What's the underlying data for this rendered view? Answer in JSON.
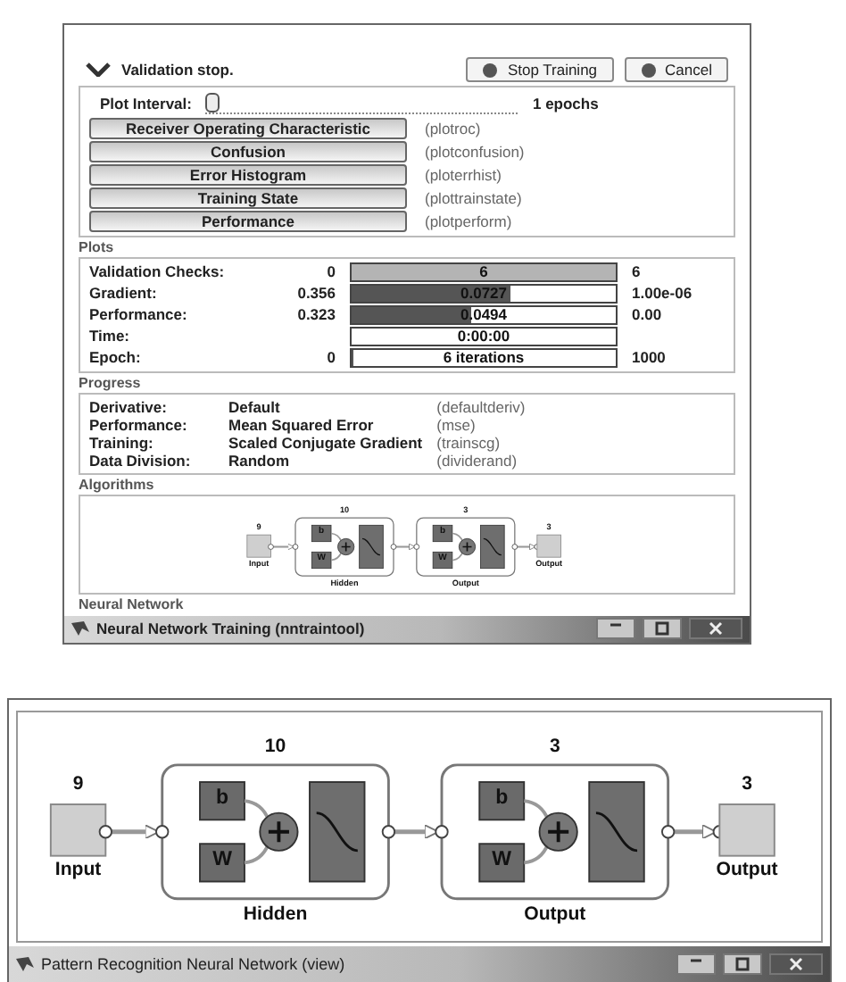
{
  "training_window": {
    "status": "Validation stop.",
    "buttons": [
      "Stop Training",
      "Cancel"
    ],
    "plot_interval": {
      "label": "Plot Interval:",
      "level": 0,
      "reading": "1 epochs"
    },
    "plots": {
      "buttons": [
        {
          "label": "Receiver Operating Characteristic",
          "function": "(plotroc)"
        },
        {
          "label": "Confusion",
          "function": "(plotconfusion)"
        },
        {
          "label": "Error Histogram",
          "function": "(ploterrhist)"
        },
        {
          "label": "Training State",
          "function": "(plottrainstate)"
        },
        {
          "label": "Performance",
          "function": "(plotperform)"
        }
      ],
      "heading": "Plots"
    },
    "progress": {
      "rows": [
        {
          "label": "Validation Checks:",
          "start": "0",
          "reading": "6",
          "end": "6",
          "level": 1,
          "color": "#b4b4b4"
        },
        {
          "label": "Gradient:",
          "start": "0.356",
          "reading": "0.0727",
          "end": "1.00e-06",
          "level": 0.6,
          "color": "#555555"
        },
        {
          "label": "Performance:",
          "start": "0.323",
          "reading": "0.0494",
          "end": "0.00",
          "level": 0.45,
          "color": "#555555"
        },
        {
          "label": "Time:",
          "reading": "0:00:00"
        },
        {
          "label": "Epoch:",
          "start": "0",
          "reading": "6 iterations",
          "end": "1000",
          "level": 0.006,
          "color": "#555555"
        }
      ],
      "heading": "Progress"
    },
    "algorithms": {
      "rows": [
        {
          "label": "Derivative:",
          "value": "Default",
          "function": "(defaultderiv)"
        },
        {
          "label": "Performance:",
          "value": "Mean Squared Error",
          "function": "(mse)"
        },
        {
          "label": "Training:",
          "value": "Scaled Conjugate Gradient",
          "function": "(trainscg)"
        },
        {
          "label": "Data Division:",
          "value": "Random",
          "function": "(dividerand)"
        }
      ],
      "heading": "Algorithms"
    },
    "network_panel": {
      "network": {
        "input": {
          "label": "Input",
          "size": "9"
        },
        "layers": [
          {
            "label": "Hidden",
            "size": "10",
            "weight_label": "W",
            "bias_label": "b"
          },
          {
            "label": "Output",
            "size": "3",
            "weight_label": "W",
            "bias_label": "b"
          }
        ],
        "output": {
          "label": "Output",
          "size": "3"
        }
      },
      "heading": "Neural Network"
    },
    "title": "Neural Network Training (nntraintool)"
  },
  "view_window": {
    "network": {
      "input": {
        "label": "Input",
        "size": "9"
      },
      "layers": [
        {
          "label": "Hidden",
          "size": "10",
          "weight_label": "W",
          "bias_label": "b"
        },
        {
          "label": "Output",
          "size": "3",
          "weight_label": "W",
          "bias_label": "b"
        }
      ],
      "output": {
        "label": "Output",
        "size": "3"
      }
    },
    "title": "Pattern Recognition Neural Network (view)"
  }
}
